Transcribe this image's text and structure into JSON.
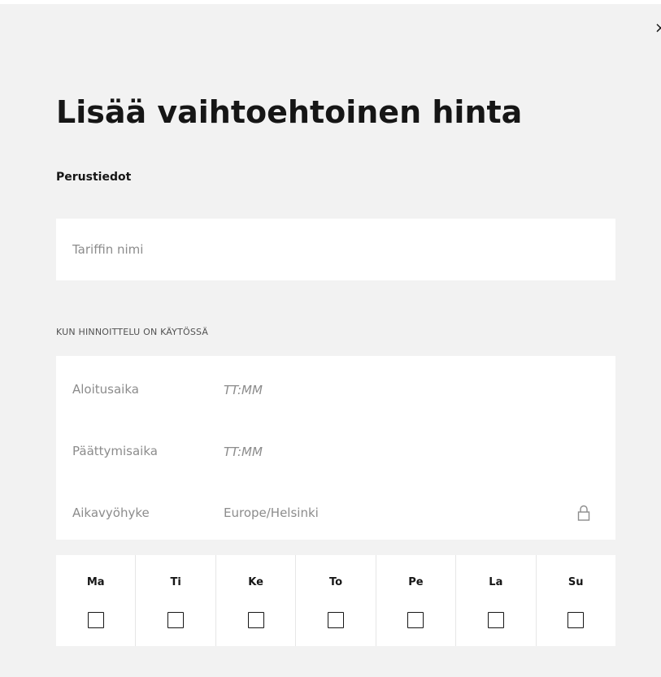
{
  "dialog": {
    "close_glyph": "×",
    "title": "Lisää vaihtoehtoinen hinta"
  },
  "basics": {
    "heading": "Perustiedot",
    "tariff_name": {
      "value": "",
      "placeholder": "Tariffin nimi"
    }
  },
  "schedule": {
    "heading": "KUN HINNOITTELU ON KÄYTÖSSÄ",
    "start": {
      "label": "Aloitusaika",
      "value": "",
      "placeholder": "TT:MM"
    },
    "end": {
      "label": "Päättymisaika",
      "value": "",
      "placeholder": "TT:MM"
    },
    "timezone": {
      "label": "Aikavyöhyke",
      "value": "Europe/Helsinki",
      "icon": "lock-icon"
    }
  },
  "weekdays": [
    {
      "label": "Ma",
      "checked": false
    },
    {
      "label": "Ti",
      "checked": false
    },
    {
      "label": "Ke",
      "checked": false
    },
    {
      "label": "To",
      "checked": false
    },
    {
      "label": "Pe",
      "checked": false
    },
    {
      "label": "La",
      "checked": false
    },
    {
      "label": "Su",
      "checked": false
    }
  ],
  "colors": {
    "background": "#f2f2f2",
    "field": "#ffffff",
    "text": "#161616",
    "placeholder": "#8c8c8c"
  }
}
